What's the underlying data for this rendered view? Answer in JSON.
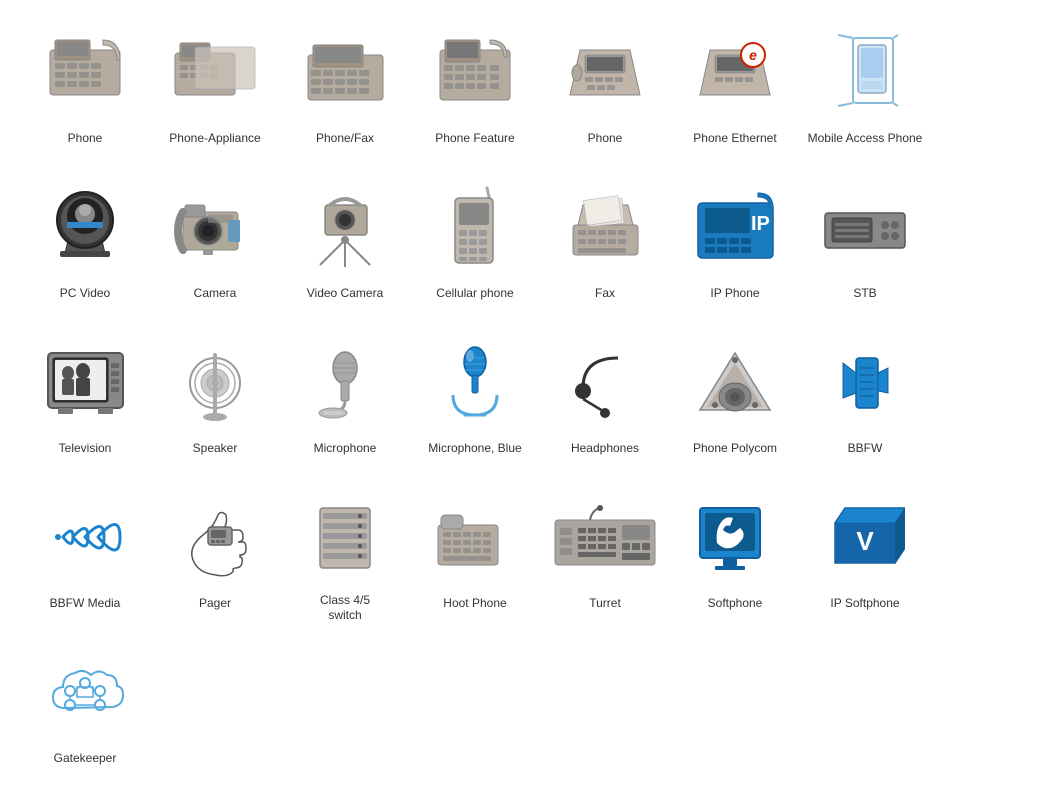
{
  "items": [
    {
      "id": "phone",
      "label": "Phone",
      "icon": "phone"
    },
    {
      "id": "phone-appliance",
      "label": "Phone-Appliance",
      "icon": "phone-appliance"
    },
    {
      "id": "phone-fax",
      "label": "Phone/Fax",
      "icon": "phone-fax"
    },
    {
      "id": "phone-feature",
      "label": "Phone Feature",
      "icon": "phone-feature"
    },
    {
      "id": "phone2",
      "label": "Phone",
      "icon": "phone2"
    },
    {
      "id": "phone-ethernet",
      "label": "Phone Ethernet",
      "icon": "phone-ethernet"
    },
    {
      "id": "mobile-access-phone",
      "label": "Mobile Access Phone",
      "icon": "mobile-access-phone"
    },
    {
      "id": "pc-video",
      "label": "PC Video",
      "icon": "pc-video"
    },
    {
      "id": "camera",
      "label": "Camera",
      "icon": "camera"
    },
    {
      "id": "video-camera",
      "label": "Video Camera",
      "icon": "video-camera"
    },
    {
      "id": "cellular-phone",
      "label": "Cellular phone",
      "icon": "cellular-phone"
    },
    {
      "id": "fax",
      "label": "Fax",
      "icon": "fax"
    },
    {
      "id": "ip-phone",
      "label": "IP Phone",
      "icon": "ip-phone"
    },
    {
      "id": "stb",
      "label": "STB",
      "icon": "stb"
    },
    {
      "id": "television",
      "label": "Television",
      "icon": "television"
    },
    {
      "id": "speaker",
      "label": "Speaker",
      "icon": "speaker"
    },
    {
      "id": "microphone",
      "label": "Microphone",
      "icon": "microphone"
    },
    {
      "id": "microphone-blue",
      "label": "Microphone, Blue",
      "icon": "microphone-blue"
    },
    {
      "id": "headphones",
      "label": "Headphones",
      "icon": "headphones"
    },
    {
      "id": "phone-polycom",
      "label": "Phone Polycom",
      "icon": "phone-polycom"
    },
    {
      "id": "bbfw",
      "label": "BBFW",
      "icon": "bbfw"
    },
    {
      "id": "bbfw-media",
      "label": "BBFW Media",
      "icon": "bbfw-media"
    },
    {
      "id": "pager",
      "label": "Pager",
      "icon": "pager"
    },
    {
      "id": "class-switch",
      "label": "Class 4/5\nswitch",
      "icon": "class-switch"
    },
    {
      "id": "hoot-phone",
      "label": "Hoot Phone",
      "icon": "hoot-phone"
    },
    {
      "id": "turret",
      "label": "Turret",
      "icon": "turret"
    },
    {
      "id": "softphone",
      "label": "Softphone",
      "icon": "softphone"
    },
    {
      "id": "ip-softphone",
      "label": "IP Softphone",
      "icon": "ip-softphone"
    },
    {
      "id": "gatekeeper",
      "label": "Gatekeeper",
      "icon": "gatekeeper"
    }
  ]
}
